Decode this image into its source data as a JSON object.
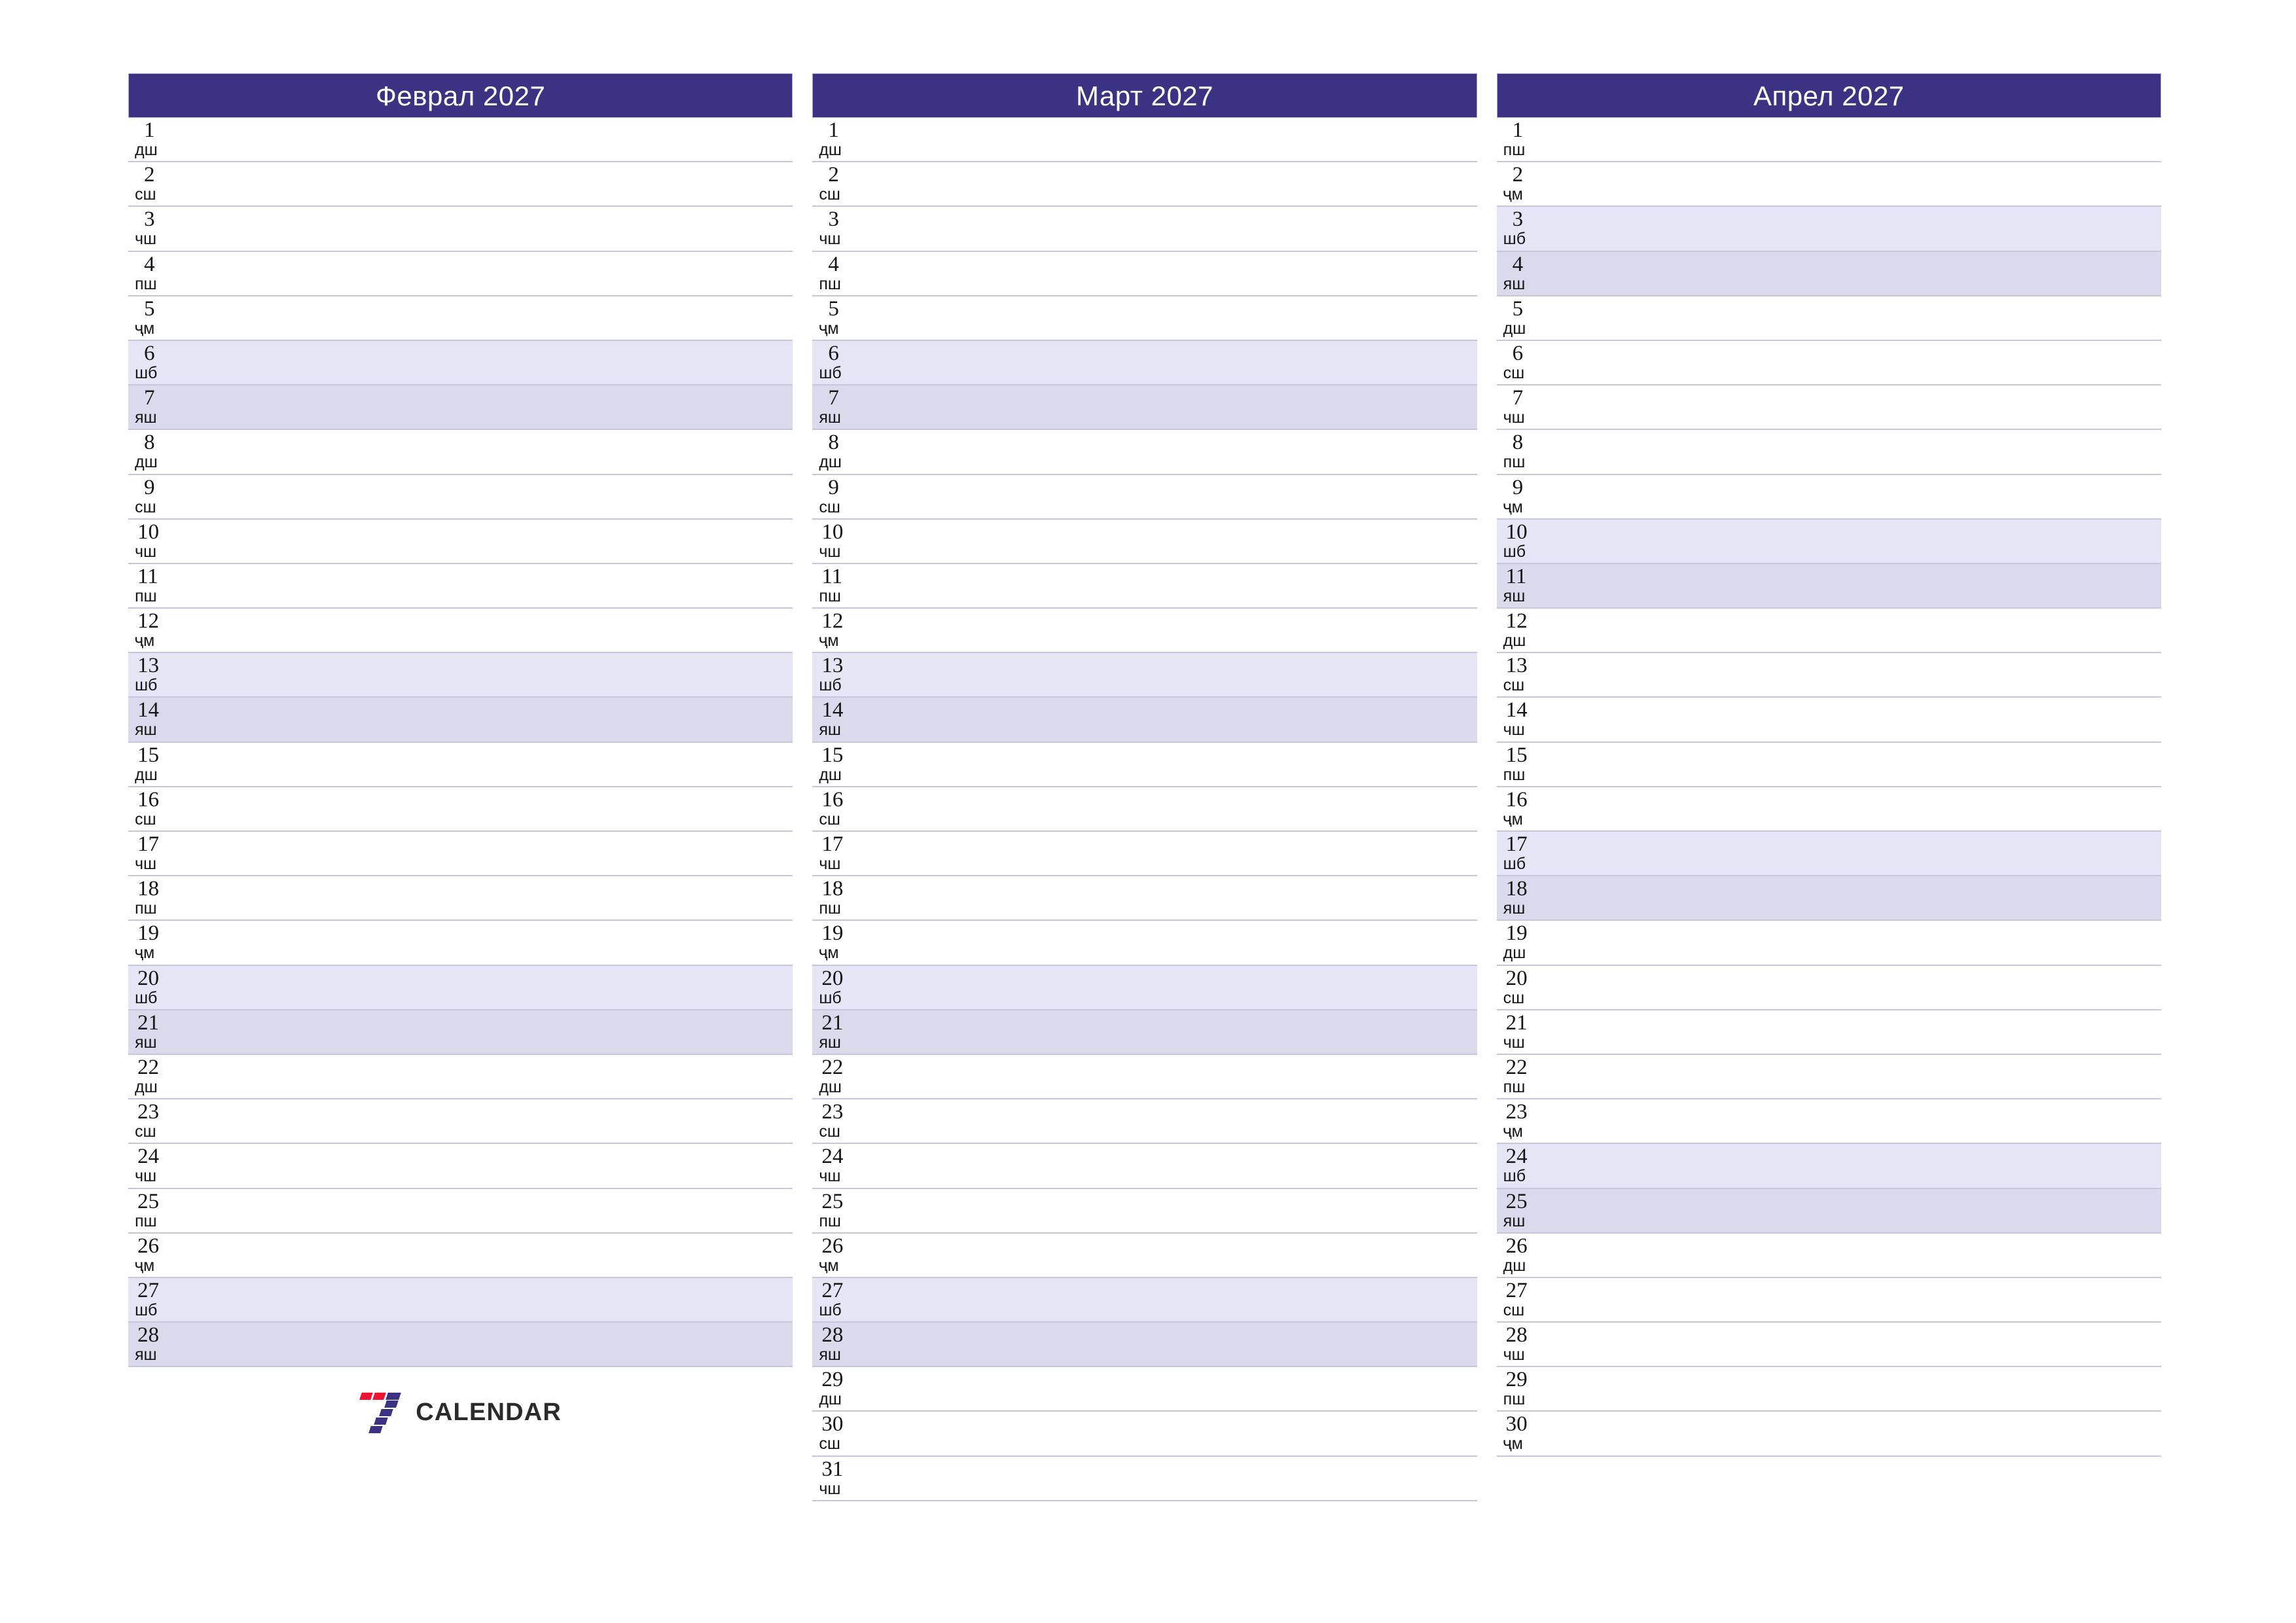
{
  "document": {
    "type": "printable-monthly-planner",
    "language": "tg",
    "orientation": "landscape"
  },
  "colors": {
    "header_bg": "#3a3383",
    "header_text": "#ffffff",
    "saturday_bg": "#e5e5f6",
    "sunday_bg": "#dbdaed",
    "row_line": "#c8c6de",
    "page_bg": "#ffffff",
    "text": "#161616",
    "logo_red": "#ef1233",
    "logo_blue": "#3a3383",
    "logo_word": "#2b2b2b"
  },
  "weekday_abbr": {
    "mon": "дш",
    "tue": "сш",
    "wed": "чш",
    "thu": "пш",
    "fri": "ҷм",
    "sat": "шб",
    "sun": "яш"
  },
  "logo": {
    "mark": "seven-stripes-icon",
    "word": "CALENDAR"
  },
  "months": [
    {
      "title": "Феврал 2027",
      "days": [
        {
          "num": "1",
          "abbr": "дш",
          "type": "weekday"
        },
        {
          "num": "2",
          "abbr": "сш",
          "type": "weekday"
        },
        {
          "num": "3",
          "abbr": "чш",
          "type": "weekday"
        },
        {
          "num": "4",
          "abbr": "пш",
          "type": "weekday"
        },
        {
          "num": "5",
          "abbr": "ҷм",
          "type": "weekday"
        },
        {
          "num": "6",
          "abbr": "шб",
          "type": "sat"
        },
        {
          "num": "7",
          "abbr": "яш",
          "type": "sun"
        },
        {
          "num": "8",
          "abbr": "дш",
          "type": "weekday"
        },
        {
          "num": "9",
          "abbr": "сш",
          "type": "weekday"
        },
        {
          "num": "10",
          "abbr": "чш",
          "type": "weekday"
        },
        {
          "num": "11",
          "abbr": "пш",
          "type": "weekday"
        },
        {
          "num": "12",
          "abbr": "ҷм",
          "type": "weekday"
        },
        {
          "num": "13",
          "abbr": "шб",
          "type": "sat"
        },
        {
          "num": "14",
          "abbr": "яш",
          "type": "sun"
        },
        {
          "num": "15",
          "abbr": "дш",
          "type": "weekday"
        },
        {
          "num": "16",
          "abbr": "сш",
          "type": "weekday"
        },
        {
          "num": "17",
          "abbr": "чш",
          "type": "weekday"
        },
        {
          "num": "18",
          "abbr": "пш",
          "type": "weekday"
        },
        {
          "num": "19",
          "abbr": "ҷм",
          "type": "weekday"
        },
        {
          "num": "20",
          "abbr": "шб",
          "type": "sat"
        },
        {
          "num": "21",
          "abbr": "яш",
          "type": "sun"
        },
        {
          "num": "22",
          "abbr": "дш",
          "type": "weekday"
        },
        {
          "num": "23",
          "abbr": "сш",
          "type": "weekday"
        },
        {
          "num": "24",
          "abbr": "чш",
          "type": "weekday"
        },
        {
          "num": "25",
          "abbr": "пш",
          "type": "weekday"
        },
        {
          "num": "26",
          "abbr": "ҷм",
          "type": "weekday"
        },
        {
          "num": "27",
          "abbr": "шб",
          "type": "sat"
        },
        {
          "num": "28",
          "abbr": "яш",
          "type": "sun"
        }
      ]
    },
    {
      "title": "Март 2027",
      "days": [
        {
          "num": "1",
          "abbr": "дш",
          "type": "weekday"
        },
        {
          "num": "2",
          "abbr": "сш",
          "type": "weekday"
        },
        {
          "num": "3",
          "abbr": "чш",
          "type": "weekday"
        },
        {
          "num": "4",
          "abbr": "пш",
          "type": "weekday"
        },
        {
          "num": "5",
          "abbr": "ҷм",
          "type": "weekday"
        },
        {
          "num": "6",
          "abbr": "шб",
          "type": "sat"
        },
        {
          "num": "7",
          "abbr": "яш",
          "type": "sun"
        },
        {
          "num": "8",
          "abbr": "дш",
          "type": "weekday"
        },
        {
          "num": "9",
          "abbr": "сш",
          "type": "weekday"
        },
        {
          "num": "10",
          "abbr": "чш",
          "type": "weekday"
        },
        {
          "num": "11",
          "abbr": "пш",
          "type": "weekday"
        },
        {
          "num": "12",
          "abbr": "ҷм",
          "type": "weekday"
        },
        {
          "num": "13",
          "abbr": "шб",
          "type": "sat"
        },
        {
          "num": "14",
          "abbr": "яш",
          "type": "sun"
        },
        {
          "num": "15",
          "abbr": "дш",
          "type": "weekday"
        },
        {
          "num": "16",
          "abbr": "сш",
          "type": "weekday"
        },
        {
          "num": "17",
          "abbr": "чш",
          "type": "weekday"
        },
        {
          "num": "18",
          "abbr": "пш",
          "type": "weekday"
        },
        {
          "num": "19",
          "abbr": "ҷм",
          "type": "weekday"
        },
        {
          "num": "20",
          "abbr": "шб",
          "type": "sat"
        },
        {
          "num": "21",
          "abbr": "яш",
          "type": "sun"
        },
        {
          "num": "22",
          "abbr": "дш",
          "type": "weekday"
        },
        {
          "num": "23",
          "abbr": "сш",
          "type": "weekday"
        },
        {
          "num": "24",
          "abbr": "чш",
          "type": "weekday"
        },
        {
          "num": "25",
          "abbr": "пш",
          "type": "weekday"
        },
        {
          "num": "26",
          "abbr": "ҷм",
          "type": "weekday"
        },
        {
          "num": "27",
          "abbr": "шб",
          "type": "sat"
        },
        {
          "num": "28",
          "abbr": "яш",
          "type": "sun"
        },
        {
          "num": "29",
          "abbr": "дш",
          "type": "weekday"
        },
        {
          "num": "30",
          "abbr": "сш",
          "type": "weekday"
        },
        {
          "num": "31",
          "abbr": "чш",
          "type": "weekday"
        }
      ]
    },
    {
      "title": "Апрел 2027",
      "days": [
        {
          "num": "1",
          "abbr": "пш",
          "type": "weekday"
        },
        {
          "num": "2",
          "abbr": "ҷм",
          "type": "weekday"
        },
        {
          "num": "3",
          "abbr": "шб",
          "type": "sat"
        },
        {
          "num": "4",
          "abbr": "яш",
          "type": "sun"
        },
        {
          "num": "5",
          "abbr": "дш",
          "type": "weekday"
        },
        {
          "num": "6",
          "abbr": "сш",
          "type": "weekday"
        },
        {
          "num": "7",
          "abbr": "чш",
          "type": "weekday"
        },
        {
          "num": "8",
          "abbr": "пш",
          "type": "weekday"
        },
        {
          "num": "9",
          "abbr": "ҷм",
          "type": "weekday"
        },
        {
          "num": "10",
          "abbr": "шб",
          "type": "sat"
        },
        {
          "num": "11",
          "abbr": "яш",
          "type": "sun"
        },
        {
          "num": "12",
          "abbr": "дш",
          "type": "weekday"
        },
        {
          "num": "13",
          "abbr": "сш",
          "type": "weekday"
        },
        {
          "num": "14",
          "abbr": "чш",
          "type": "weekday"
        },
        {
          "num": "15",
          "abbr": "пш",
          "type": "weekday"
        },
        {
          "num": "16",
          "abbr": "ҷм",
          "type": "weekday"
        },
        {
          "num": "17",
          "abbr": "шб",
          "type": "sat"
        },
        {
          "num": "18",
          "abbr": "яш",
          "type": "sun"
        },
        {
          "num": "19",
          "abbr": "дш",
          "type": "weekday"
        },
        {
          "num": "20",
          "abbr": "сш",
          "type": "weekday"
        },
        {
          "num": "21",
          "abbr": "чш",
          "type": "weekday"
        },
        {
          "num": "22",
          "abbr": "пш",
          "type": "weekday"
        },
        {
          "num": "23",
          "abbr": "ҷм",
          "type": "weekday"
        },
        {
          "num": "24",
          "abbr": "шб",
          "type": "sat"
        },
        {
          "num": "25",
          "abbr": "яш",
          "type": "sun"
        },
        {
          "num": "26",
          "abbr": "дш",
          "type": "weekday"
        },
        {
          "num": "27",
          "abbr": "сш",
          "type": "weekday"
        },
        {
          "num": "28",
          "abbr": "чш",
          "type": "weekday"
        },
        {
          "num": "29",
          "abbr": "пш",
          "type": "weekday"
        },
        {
          "num": "30",
          "abbr": "ҷм",
          "type": "weekday"
        }
      ]
    }
  ]
}
